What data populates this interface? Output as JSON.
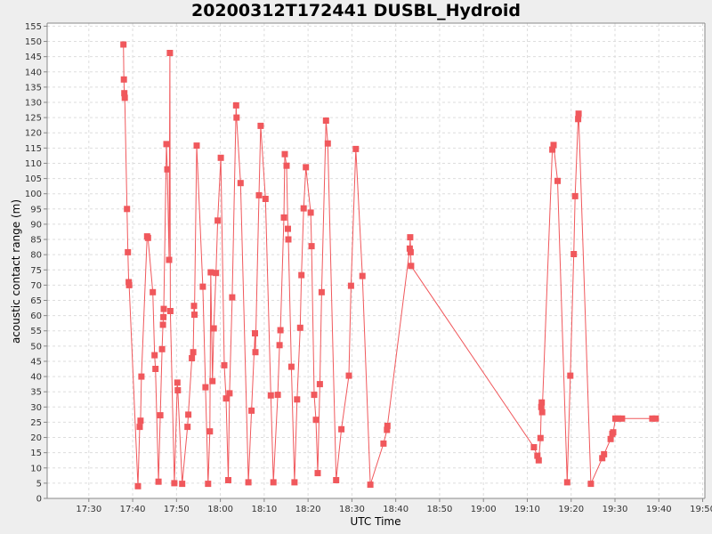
{
  "chart_data": {
    "type": "line",
    "title": "20200312T172441 DUSBL_Hydroid",
    "xlabel": "UTC Time",
    "ylabel": "acoustic contact range (m)",
    "x_tick_labels": [
      "17:30",
      "17:40",
      "17:50",
      "18:00",
      "18:10",
      "18:20",
      "18:30",
      "18:40",
      "18:50",
      "19:00",
      "19:10",
      "19:20",
      "19:30",
      "19:40",
      "19:50"
    ],
    "x_tick_minutes": [
      1050,
      1060,
      1070,
      1080,
      1090,
      1100,
      1110,
      1120,
      1130,
      1140,
      1150,
      1160,
      1170,
      1180,
      1190
    ],
    "xlim_minutes": [
      1040.5,
      1190.5
    ],
    "ylim": [
      0,
      156
    ],
    "y_tick_step": 5,
    "grid": true,
    "legend": "none",
    "series": [
      {
        "color": "#f0585c",
        "marker": "square",
        "points": [
          [
            1057.9,
            149
          ],
          [
            1058.0,
            137.5
          ],
          [
            1058.1,
            133
          ],
          [
            1058.2,
            131.5
          ],
          [
            1058.7,
            95
          ],
          [
            1058.9,
            80.8
          ],
          [
            1059.1,
            71
          ],
          [
            1059.2,
            70
          ],
          [
            1061.2,
            4
          ],
          [
            1061.6,
            23.5
          ],
          [
            1061.8,
            25.5
          ],
          [
            1062.0,
            40
          ],
          [
            1063.3,
            86
          ],
          [
            1063.5,
            85.5
          ],
          [
            1064.6,
            67.7
          ],
          [
            1065.0,
            47
          ],
          [
            1065.2,
            42.5
          ],
          [
            1065.9,
            5.5
          ],
          [
            1066.3,
            27.3
          ],
          [
            1066.7,
            49
          ],
          [
            1066.9,
            57
          ],
          [
            1067.0,
            59.5
          ],
          [
            1067.1,
            62.2
          ],
          [
            1067.7,
            116.3
          ],
          [
            1067.9,
            108
          ],
          [
            1068.3,
            78.3
          ],
          [
            1068.5,
            146.2
          ],
          [
            1068.6,
            61.5
          ],
          [
            1069.5,
            5
          ],
          [
            1070.2,
            38
          ],
          [
            1070.3,
            35.5
          ],
          [
            1071.3,
            4.8
          ],
          [
            1072.5,
            23.5
          ],
          [
            1072.7,
            27.5
          ],
          [
            1073.5,
            46
          ],
          [
            1073.8,
            48
          ],
          [
            1074.0,
            63.2
          ],
          [
            1074.1,
            60.3
          ],
          [
            1074.6,
            115.8
          ],
          [
            1076.0,
            69.5
          ],
          [
            1076.6,
            36.5
          ],
          [
            1077.2,
            4.8
          ],
          [
            1077.6,
            22
          ],
          [
            1077.8,
            74.2
          ],
          [
            1078.2,
            38.5
          ],
          [
            1078.5,
            55.8
          ],
          [
            1079.0,
            74
          ],
          [
            1079.4,
            91.2
          ],
          [
            1080.1,
            111.8
          ],
          [
            1080.9,
            43.7
          ],
          [
            1081.3,
            32.8
          ],
          [
            1081.8,
            6
          ],
          [
            1082.1,
            34.5
          ],
          [
            1082.7,
            66
          ],
          [
            1083.6,
            129
          ],
          [
            1083.7,
            125
          ],
          [
            1084.6,
            103.5
          ],
          [
            1086.4,
            5.3
          ],
          [
            1087.1,
            28.8
          ],
          [
            1087.9,
            54.2
          ],
          [
            1088.0,
            48
          ],
          [
            1088.8,
            99.5
          ],
          [
            1089.2,
            122.3
          ],
          [
            1090.3,
            98.3
          ],
          [
            1091.5,
            33.8
          ],
          [
            1092.1,
            5.3
          ],
          [
            1093.1,
            34
          ],
          [
            1093.5,
            50.3
          ],
          [
            1093.7,
            55.2
          ],
          [
            1094.5,
            92.2
          ],
          [
            1094.7,
            113
          ],
          [
            1095.1,
            109.2
          ],
          [
            1095.4,
            88.5
          ],
          [
            1095.5,
            85
          ],
          [
            1096.2,
            43.2
          ],
          [
            1096.9,
            5.3
          ],
          [
            1097.5,
            32.5
          ],
          [
            1098.2,
            56
          ],
          [
            1098.5,
            73.3
          ],
          [
            1099.0,
            95.2
          ],
          [
            1099.5,
            108.7
          ],
          [
            1100.6,
            93.8
          ],
          [
            1100.8,
            82.8
          ],
          [
            1101.4,
            34
          ],
          [
            1101.8,
            25.8
          ],
          [
            1102.2,
            8.3
          ],
          [
            1102.7,
            37.5
          ],
          [
            1103.1,
            67.7
          ],
          [
            1104.1,
            124
          ],
          [
            1104.5,
            116.5
          ],
          [
            1106.4,
            6
          ],
          [
            1107.6,
            22.7
          ],
          [
            1109.3,
            40.3
          ],
          [
            1109.8,
            69.8
          ],
          [
            1110.9,
            114.7
          ],
          [
            1112.4,
            73
          ],
          [
            1114.2,
            4.5
          ],
          [
            1117.2,
            18
          ],
          [
            1118.0,
            22.5
          ],
          [
            1118.1,
            23.8
          ],
          [
            1123.2,
            82
          ],
          [
            1123.3,
            85.7
          ],
          [
            1123.4,
            80.8
          ],
          [
            1123.5,
            76.3
          ],
          [
            1151.5,
            16.8
          ],
          [
            1152.3,
            14
          ],
          [
            1152.6,
            12.5
          ],
          [
            1153.0,
            19.8
          ],
          [
            1153.2,
            30
          ],
          [
            1153.3,
            31.5
          ],
          [
            1153.4,
            28.3
          ],
          [
            1155.7,
            114.5
          ],
          [
            1156.0,
            116
          ],
          [
            1156.9,
            104.2
          ],
          [
            1159.1,
            5.3
          ],
          [
            1159.8,
            40.3
          ],
          [
            1160.6,
            80.2
          ],
          [
            1160.9,
            99.2
          ],
          [
            1161.6,
            124.5
          ],
          [
            1161.7,
            126.3
          ],
          [
            1164.5,
            4.8
          ],
          [
            1167.1,
            13.2
          ],
          [
            1167.5,
            14.5
          ],
          [
            1169.0,
            19.5
          ],
          [
            1169.4,
            21.2
          ],
          [
            1169.6,
            21.7
          ],
          [
            1170.1,
            26.2
          ],
          [
            1170.7,
            26.2
          ],
          [
            1171.6,
            26.2
          ],
          [
            1178.5,
            26.2
          ],
          [
            1179.3,
            26.2
          ]
        ]
      }
    ]
  }
}
